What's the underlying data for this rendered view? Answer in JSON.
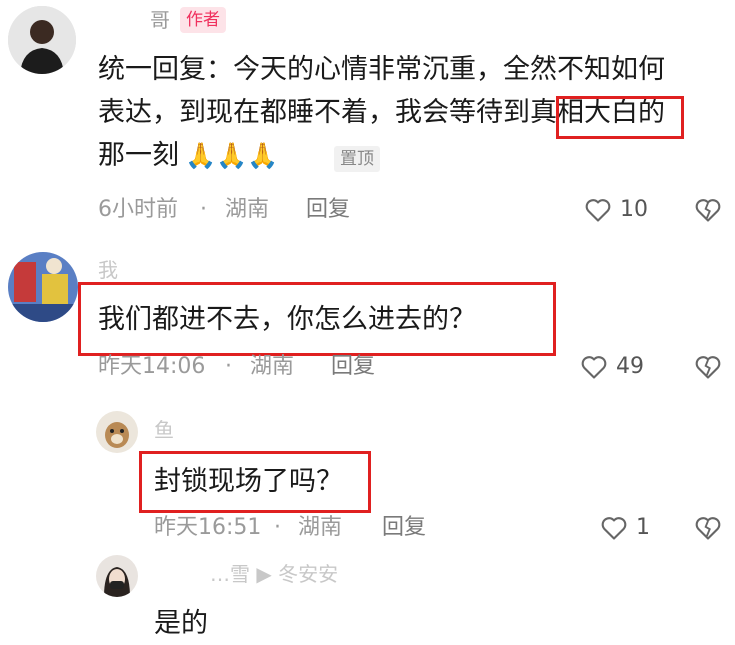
{
  "comments": [
    {
      "name_partial": "哥",
      "author_tag": "作者",
      "text_line1": "统一回复：今天的心情非常沉重，全然不知如何",
      "text_line2a": "表达，到现在都睡不着，我会等待到",
      "text_line2b": "真相大白",
      "text_line2c": "的",
      "text_line3": "那一刻",
      "emoji": "🙏🙏🙏",
      "pinned": "置顶",
      "time": "6小时前",
      "location": "湖南",
      "reply": "回复",
      "likes": "10"
    },
    {
      "name_partial": "我",
      "text": "我们都进不去，你怎么进去的？",
      "time": "昨天14:06",
      "location": "湖南",
      "reply": "回复",
      "likes": "49"
    },
    {
      "name_partial": "鱼",
      "text": "封锁现场了吗？",
      "time": "昨天16:51",
      "location": "湖南",
      "reply": "回复",
      "likes": "1"
    },
    {
      "name_partial": "…雪 ▶ 冬安安",
      "text": "是的"
    }
  ],
  "meta_separator": "·"
}
